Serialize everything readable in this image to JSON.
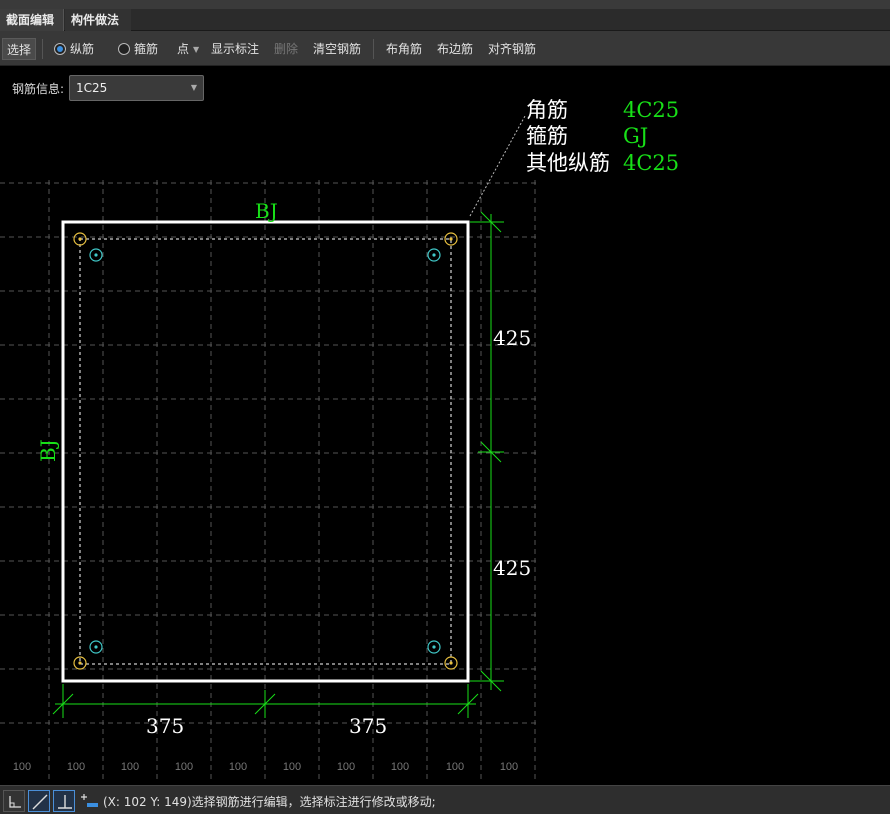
{
  "tabs": [
    {
      "label": "截面编辑"
    },
    {
      "label": "构件做法"
    }
  ],
  "toolbar": {
    "select": "选择",
    "longitudinal": "纵筋",
    "stirrup": "箍筋",
    "point": "点",
    "show_annotation": "显示标注",
    "delete": "删除",
    "clear_rebar": "清空钢筋",
    "corner_rebar": "布角筋",
    "edge_rebar": "布边筋",
    "align_rebar": "对齐钢筋"
  },
  "rebar_info": {
    "label": "钢筋信息:",
    "value": "1C25"
  },
  "legend": {
    "corner_label": "角筋",
    "corner_value": "4C25",
    "stirrup_label": "箍筋",
    "stirrup_value": "GJ",
    "other_label": "其他纵筋",
    "other_value": "4C25"
  },
  "drawing": {
    "top_label": "BJ",
    "side_label": "BJ",
    "dim_right_upper": "425",
    "dim_right_lower": "425",
    "dim_bottom_left": "375",
    "dim_bottom_right": "375",
    "ruler_labels": [
      "100",
      "100",
      "100",
      "100",
      "100",
      "100",
      "100",
      "100",
      "100",
      "100"
    ]
  },
  "colors": {
    "green": "#18e018",
    "white": "#ffffff",
    "corner_rebar": "#e8c040",
    "side_rebar": "#40c8c8",
    "grid": "#555555"
  },
  "status": {
    "text": "(X: 102 Y: 149)选择钢筋进行编辑，选择标注进行修改或移动;"
  }
}
